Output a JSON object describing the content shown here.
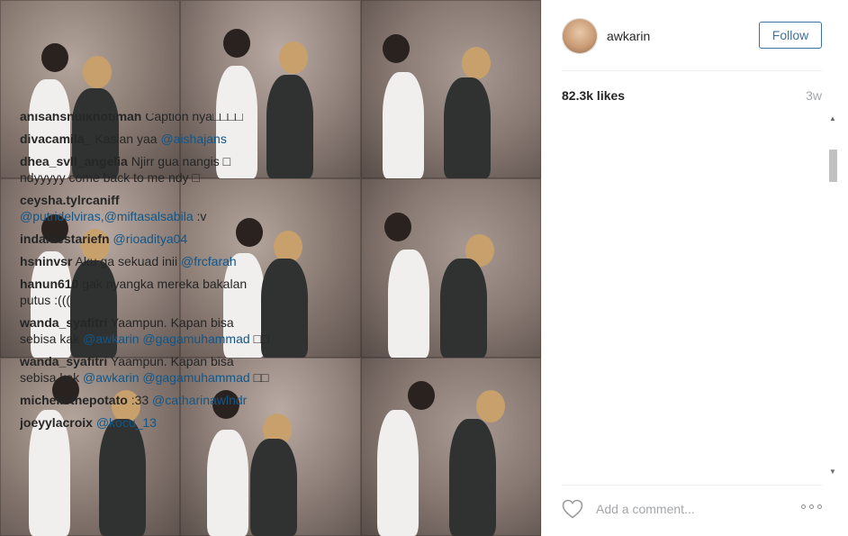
{
  "photo": {
    "alt_icon": "collage-photo"
  },
  "header": {
    "username": "awkarin",
    "follow_label": "Follow"
  },
  "stats": {
    "likes": "82.3k likes",
    "time": "3w"
  },
  "comments": [
    {
      "user": "anisahsnulkhotimah",
      "text": "Caption nya□□□□"
    },
    {
      "user": "divacamila_",
      "text": "Kasian yaa",
      "mention": "@aishajans"
    },
    {
      "user": "dhea_svll_angelia",
      "text": "Njirr gua nangis □ ndyyyyy come back to me ndy □"
    },
    {
      "user": "ceysha.tylrcaniff",
      "text": "",
      "mention": "@putridelviras,@miftasalsabila",
      "after": ":v"
    },
    {
      "user": "indahlestariefn",
      "text": "",
      "mention": "@rioaditya04"
    },
    {
      "user": "hsninvsr",
      "text": "Aku ga sekuad inii",
      "mention": "@frcfarah"
    },
    {
      "user": "hanun610",
      "text": "gak nyangka mereka bakalan putus :((("
    },
    {
      "user": "wanda_syafitri",
      "text": "Yaampun. Kapan bisa sebisa kak",
      "mention": "@awkarin @gagamuhammad",
      "after": "□□"
    },
    {
      "user": "wanda_syafitri",
      "text": "Yaampun. Kapan bisa sebisa kak",
      "mention": "@awkarin @gagamuhammad",
      "after": "□□"
    },
    {
      "user": "michellethepotato",
      "text": ":33",
      "mention": "@catharinawlndr"
    },
    {
      "user": "joeyylacroix",
      "text": "",
      "mention": "@kocu_13"
    }
  ],
  "comment_box": {
    "placeholder": "Add a comment..."
  },
  "icons": {
    "heart": "heart-outline-icon",
    "more": "more-options-icon",
    "scroll_up": "scroll-up-arrow-icon",
    "scroll_down": "scroll-down-arrow-icon"
  },
  "colors": {
    "follow": "#3f729b",
    "mention": "#125688",
    "muted": "#a5a7aa"
  }
}
